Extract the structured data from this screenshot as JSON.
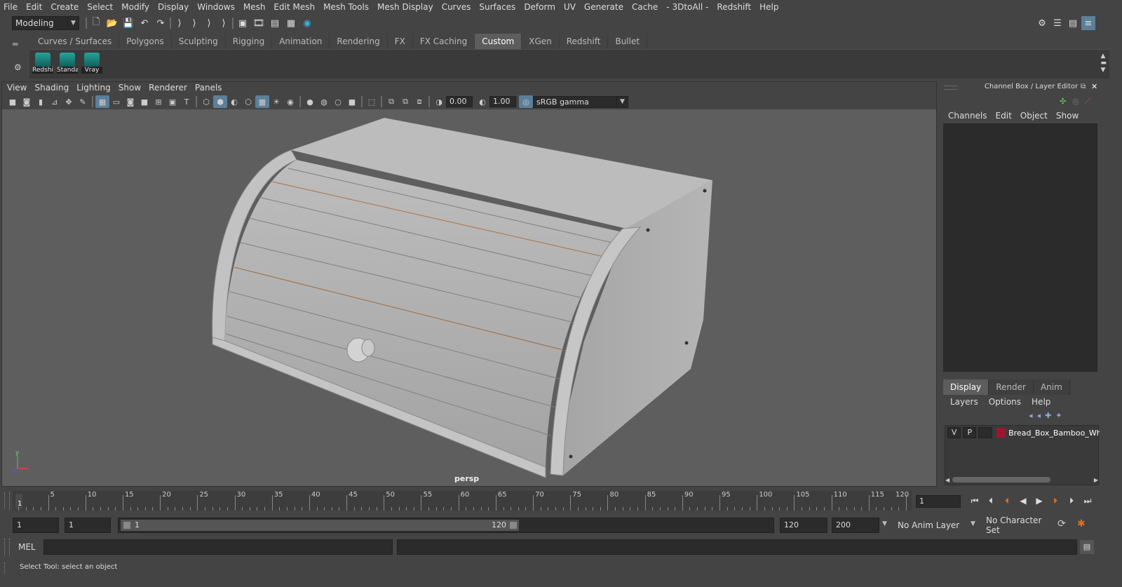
{
  "menubar": [
    "File",
    "Edit",
    "Create",
    "Select",
    "Modify",
    "Display",
    "Windows",
    "Mesh",
    "Edit Mesh",
    "Mesh Tools",
    "Mesh Display",
    "Curves",
    "Surfaces",
    "Deform",
    "UV",
    "Generate",
    "Cache",
    "- 3DtoAll -",
    "Redshift",
    "Help"
  ],
  "statusline": {
    "mode": "Modeling"
  },
  "shelf": {
    "tabs": [
      "Curves / Surfaces",
      "Polygons",
      "Sculpting",
      "Rigging",
      "Animation",
      "Rendering",
      "FX",
      "FX Caching",
      "Custom",
      "XGen",
      "Redshift",
      "Bullet"
    ],
    "active_tab": "Custom",
    "items": [
      {
        "label": "Redshif",
        "icon": "redshift-shelf-icon"
      },
      {
        "label": "Standar",
        "icon": "standard-shelf-icon"
      },
      {
        "label": "Vray",
        "icon": "vray-shelf-icon"
      }
    ]
  },
  "viewport": {
    "menu": [
      "View",
      "Shading",
      "Lighting",
      "Show",
      "Renderer",
      "Panels"
    ],
    "exposure": "0.00",
    "gamma": "1.00",
    "color_space": "sRGB gamma",
    "camera_label": "persp",
    "axis_label": "y",
    "background_color": "#5e5e5e",
    "model_color": "#b4b4b4"
  },
  "channel_box": {
    "title": "Channel Box / Layer Editor",
    "menu": [
      "Channels",
      "Edit",
      "Object",
      "Show"
    ]
  },
  "layer_editor": {
    "tabs": [
      "Display",
      "Render",
      "Anim"
    ],
    "active_tab": "Display",
    "menu": [
      "Layers",
      "Options",
      "Help"
    ],
    "layers": [
      {
        "visible": "V",
        "playback": "P",
        "color": "#a0152e",
        "name": "Bread_Box_Bamboo_Whi"
      }
    ]
  },
  "timeline": {
    "ticks": [
      "5",
      "10",
      "15",
      "20",
      "25",
      "30",
      "35",
      "40",
      "45",
      "50",
      "55",
      "60",
      "65",
      "70",
      "75",
      "80",
      "85",
      "90",
      "95",
      "100",
      "105",
      "110",
      "115",
      "120"
    ],
    "start_label": "1",
    "current_frame": "1"
  },
  "range": {
    "start": "1",
    "playback_start": "1",
    "slider_start": "1",
    "slider_end": "120",
    "playback_end": "120",
    "end": "200",
    "anim_layer": "No Anim Layer",
    "character_set": "No Character Set"
  },
  "command_line": {
    "label": "MEL"
  },
  "help_line": "Select Tool: select an object"
}
